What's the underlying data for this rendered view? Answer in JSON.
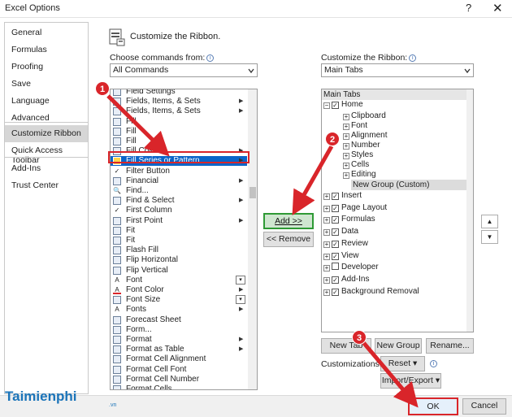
{
  "window": {
    "title": "Excel Options",
    "help": "?",
    "close": "✕"
  },
  "nav": {
    "items": [
      "General",
      "Formulas",
      "Proofing",
      "Save",
      "Language",
      "Advanced",
      "Customize Ribbon",
      "Quick Access Toolbar",
      "Add-Ins",
      "Trust Center"
    ],
    "selected": "Customize Ribbon"
  },
  "heading": "Customize the Ribbon.",
  "choose_label": "Choose commands from:",
  "choose_value": "All Commands",
  "customize_label": "Customize the Ribbon:",
  "customize_value": "Main Tabs",
  "commands": [
    {
      "label": "Field Settings",
      "icon": "field-settings-icon",
      "extra": ""
    },
    {
      "label": "Fields, Items, & Sets",
      "icon": "fields-icon",
      "extra": "submenu"
    },
    {
      "label": "Fields, Items, & Sets",
      "icon": "fields-icon",
      "extra": "submenu"
    },
    {
      "label": "Fill",
      "icon": "fill-icon",
      "extra": ""
    },
    {
      "label": "Fill",
      "icon": "fill-icon",
      "extra": ""
    },
    {
      "label": "Fill",
      "icon": "fill-icon",
      "extra": ""
    },
    {
      "label": "Fill Color",
      "icon": "fill-color-icon",
      "extra": "submenu"
    },
    {
      "label": "Fill Series or Pattern",
      "icon": "fill-series-icon",
      "extra": "submenu"
    },
    {
      "label": "Filter Button",
      "icon": "check-icon",
      "extra": ""
    },
    {
      "label": "Financial",
      "icon": "financial-icon",
      "extra": "submenu"
    },
    {
      "label": "Find...",
      "icon": "find-icon",
      "extra": ""
    },
    {
      "label": "Find & Select",
      "icon": "find-select-icon",
      "extra": "submenu"
    },
    {
      "label": "First Column",
      "icon": "check-icon",
      "extra": ""
    },
    {
      "label": "First Point",
      "icon": "first-point-icon",
      "extra": "submenu"
    },
    {
      "label": "Fit",
      "icon": "fit-icon",
      "extra": ""
    },
    {
      "label": "Fit",
      "icon": "fit-icon",
      "extra": ""
    },
    {
      "label": "Flash Fill",
      "icon": "flash-fill-icon",
      "extra": ""
    },
    {
      "label": "Flip Horizontal",
      "icon": "flip-horizontal-icon",
      "extra": ""
    },
    {
      "label": "Flip Vertical",
      "icon": "flip-vertical-icon",
      "extra": ""
    },
    {
      "label": "Font",
      "icon": "font-icon",
      "extra": "dropdown"
    },
    {
      "label": "Font Color",
      "icon": "font-color-icon",
      "extra": "submenu"
    },
    {
      "label": "Font Size",
      "icon": "font-size-icon",
      "extra": "dropdown"
    },
    {
      "label": "Fonts",
      "icon": "fonts-icon",
      "extra": "submenu"
    },
    {
      "label": "Forecast Sheet",
      "icon": "forecast-icon",
      "extra": ""
    },
    {
      "label": "Form...",
      "icon": "form-icon",
      "extra": ""
    },
    {
      "label": "Format",
      "icon": "format-icon",
      "extra": "submenu"
    },
    {
      "label": "Format as Table",
      "icon": "format-table-icon",
      "extra": "submenu"
    },
    {
      "label": "Format Cell Alignment",
      "icon": "cell-alignment-icon",
      "extra": ""
    },
    {
      "label": "Format Cell Font",
      "icon": "cell-font-icon",
      "extra": ""
    },
    {
      "label": "Format Cell Number",
      "icon": "cell-number-icon",
      "extra": ""
    },
    {
      "label": "Format Cells",
      "icon": "format-cells-icon",
      "extra": ""
    }
  ],
  "buttons": {
    "add": "Add >>",
    "remove": "<< Remove",
    "new_tab": "New Tab",
    "new_group": "New Group",
    "rename": "Rename...",
    "customizations_label": "Customizations:",
    "reset": "Reset ▾",
    "import_export": "Import/Export ▾",
    "ok": "OK",
    "cancel": "Cancel",
    "move_up": "▲",
    "move_down": "▼"
  },
  "tree": {
    "header": "Main Tabs",
    "home": "Home",
    "home_groups": [
      "Clipboard",
      "Font",
      "Alignment",
      "Number",
      "Styles",
      "Cells",
      "Editing"
    ],
    "new_group": "New Group (Custom)",
    "tabs": [
      {
        "label": "Insert",
        "checked": true
      },
      {
        "label": "Page Layout",
        "checked": true
      },
      {
        "label": "Formulas",
        "checked": true
      },
      {
        "label": "Data",
        "checked": true
      },
      {
        "label": "Review",
        "checked": true
      },
      {
        "label": "View",
        "checked": true
      },
      {
        "label": "Developer",
        "checked": false
      },
      {
        "label": "Add-Ins",
        "checked": true
      },
      {
        "label": "Background Removal",
        "checked": true
      }
    ]
  },
  "annotations": [
    "1",
    "2",
    "3"
  ],
  "watermark": {
    "brand": "Taimienphi",
    "suffix": ".vn"
  },
  "colors": {
    "accent": "#0a64c8",
    "annotation": "#d9252a",
    "highlight_green": "#2e9a35"
  }
}
